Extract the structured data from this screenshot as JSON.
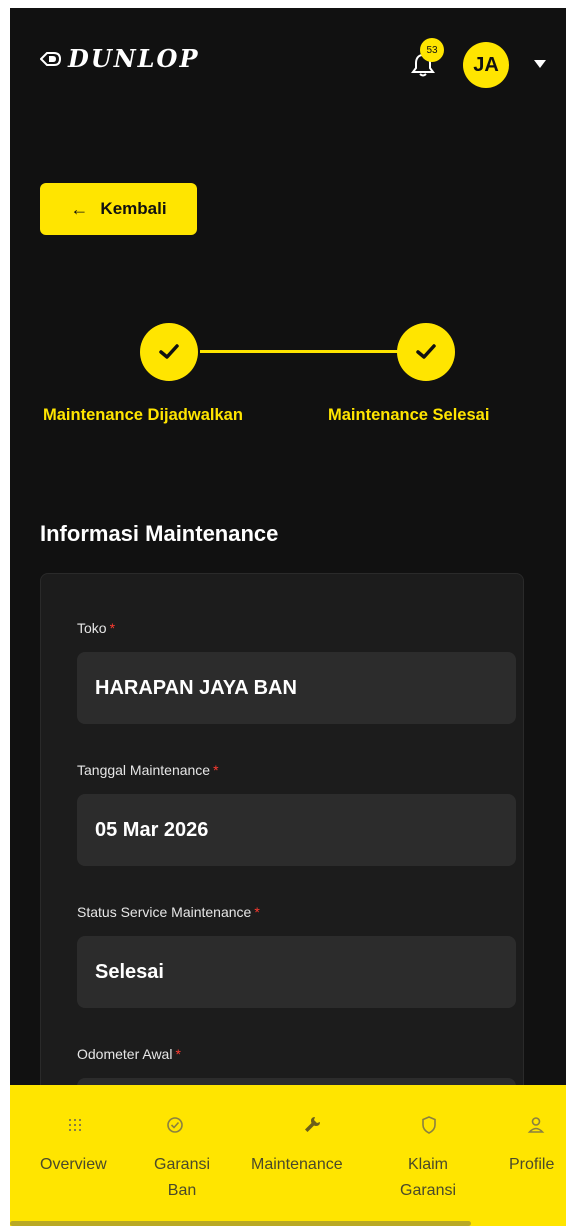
{
  "header": {
    "logo_text": "DUNLOP",
    "notification_count": "53",
    "avatar_initials": "JA"
  },
  "back_button": {
    "label": "Kembali"
  },
  "stepper": {
    "steps": [
      {
        "label": "Maintenance Dijadwalkan",
        "status": "completed"
      },
      {
        "label": "Maintenance Selesai",
        "status": "completed"
      }
    ]
  },
  "section": {
    "title": "Informasi Maintenance",
    "fields": [
      {
        "label": "Toko",
        "required_mark": "*",
        "value": "HARAPAN JAYA BAN"
      },
      {
        "label": "Tanggal Maintenance",
        "required_mark": "*",
        "value": "05 Mar 2026"
      },
      {
        "label": "Status Service Maintenance",
        "required_mark": "*",
        "value": "Selesai"
      },
      {
        "label": "Odometer Awal",
        "required_mark": "*",
        "value": ""
      }
    ]
  },
  "bottom_nav": {
    "items": [
      {
        "label": "Overview",
        "icon": "grid-icon"
      },
      {
        "label": "Garansi\nBan",
        "icon": "check-circle-icon"
      },
      {
        "label": "Maintenance",
        "icon": "wrench-icon"
      },
      {
        "label": "Klaim\nGaransi",
        "icon": "shield-icon"
      },
      {
        "label": "Profile",
        "icon": "user-icon"
      }
    ]
  },
  "colors": {
    "accent": "#FFE500",
    "background": "#111111",
    "card": "#1c1c1c",
    "input": "#2c2c2c",
    "required": "#ff3b30"
  }
}
